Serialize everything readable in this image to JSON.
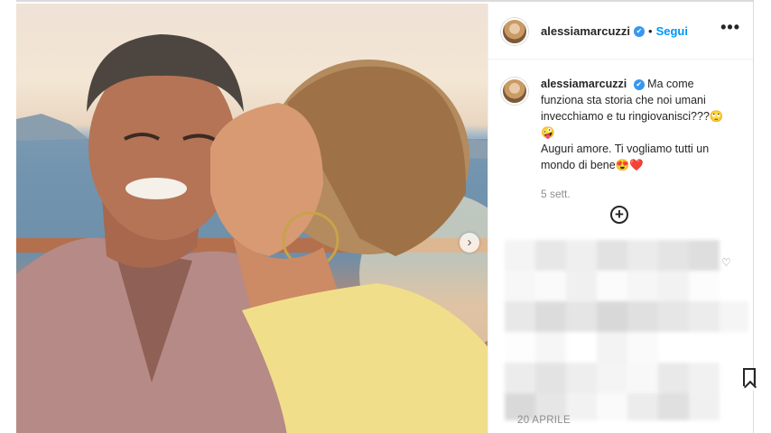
{
  "post": {
    "username": "alessiamarcuzzi",
    "verified_badge": "✔",
    "separator": "•",
    "follow_label": "Segui",
    "more_icon": "•••",
    "caption_line1": "Ma come funziona sta storia che noi umani invecchiamo e tu ringiovanisci???🙄🤪",
    "caption_line2": "Auguri amore. Ti vogliamo tutti un mondo di bene😍❤️",
    "time_ago": "5 sett.",
    "add_comment_icon": "+",
    "next_icon": "›",
    "heart_icon": "♡",
    "date": "20 APRILE"
  },
  "colors": {
    "accent": "#0095f6",
    "verified": "#3897f0",
    "muted": "#8e8e8e",
    "border": "#dbdbdb"
  }
}
